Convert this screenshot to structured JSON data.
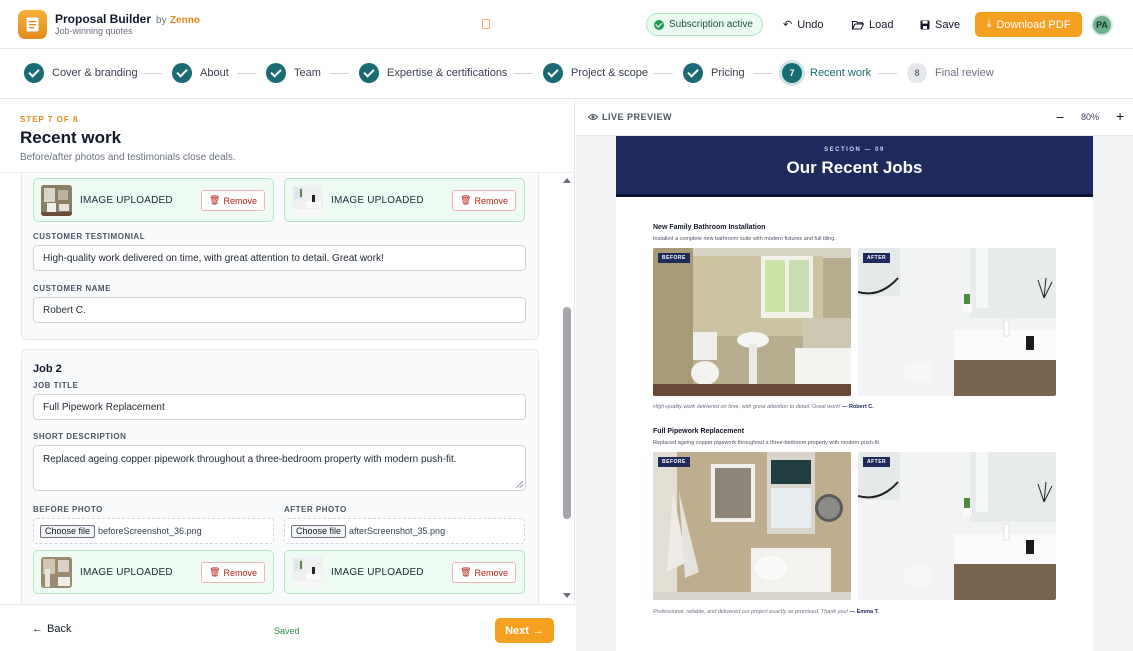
{
  "app": {
    "title": "Proposal Builder",
    "by": "by",
    "brand": "Zenno",
    "subtitle": "Job-winning quotes",
    "subscription": "Subscription active",
    "undo": "Undo",
    "load": "Load",
    "save": "Save",
    "download": "Download PDF",
    "user_initials": "PA"
  },
  "stepper": {
    "steps": [
      {
        "label": "Cover & branding",
        "status": "done"
      },
      {
        "label": "About",
        "status": "done"
      },
      {
        "label": "Team",
        "status": "done"
      },
      {
        "label": "Expertise & certifications",
        "status": "done"
      },
      {
        "label": "Project & scope",
        "status": "done"
      },
      {
        "label": "Pricing",
        "status": "done"
      },
      {
        "label": "Recent work",
        "status": "current",
        "num": "7"
      },
      {
        "label": "Final review",
        "status": "future",
        "num": "8"
      }
    ]
  },
  "form": {
    "step_of": "STEP 7 OF 8",
    "title": "Recent work",
    "subtitle": "Before/after photos and testimonials close deals.",
    "uploaded_text": "IMAGE UPLOADED",
    "remove_label": "Remove",
    "job1": {
      "testimonial_label": "CUSTOMER TESTIMONIAL",
      "testimonial": "High-quality work delivered on time, with great attention to detail. Great work!",
      "name_label": "CUSTOMER NAME",
      "name": "Robert C."
    },
    "job2": {
      "heading": "Job 2",
      "title_label": "JOB TITLE",
      "title": "Full Pipework Replacement",
      "desc_label": "SHORT DESCRIPTION",
      "desc": "Replaced ageing copper pipework throughout a three-bedroom property with modern push-fit.",
      "before_label": "BEFORE PHOTO",
      "after_label": "AFTER PHOTO",
      "choose_label": "Choose file",
      "before_file": "beforeScreenshot_36.png",
      "after_file": "afterScreenshot_35.png"
    },
    "back": "Back",
    "saved": "Saved",
    "next": "Next"
  },
  "preview": {
    "label": "LIVE PREVIEW",
    "zoom": "80%",
    "section_kicker": "SECTION — 09",
    "section_title": "Our Recent Jobs",
    "before_tag": "BEFORE",
    "after_tag": "AFTER",
    "jobs": [
      {
        "title": "New Family Bathroom Installation",
        "desc": "Installed a complete new bathroom suite with modern fixtures and full tiling.",
        "quote": "High-quality work delivered on time, with great attention to detail. Great work!",
        "who": "— Robert C."
      },
      {
        "title": "Full Pipework Replacement",
        "desc": "Replaced ageing copper pipework throughout a three-bedroom property with modern push-fit.",
        "quote": "Professional, reliable, and delivered our project exactly as promised. Thank you!",
        "who": "— Emma T."
      }
    ]
  }
}
